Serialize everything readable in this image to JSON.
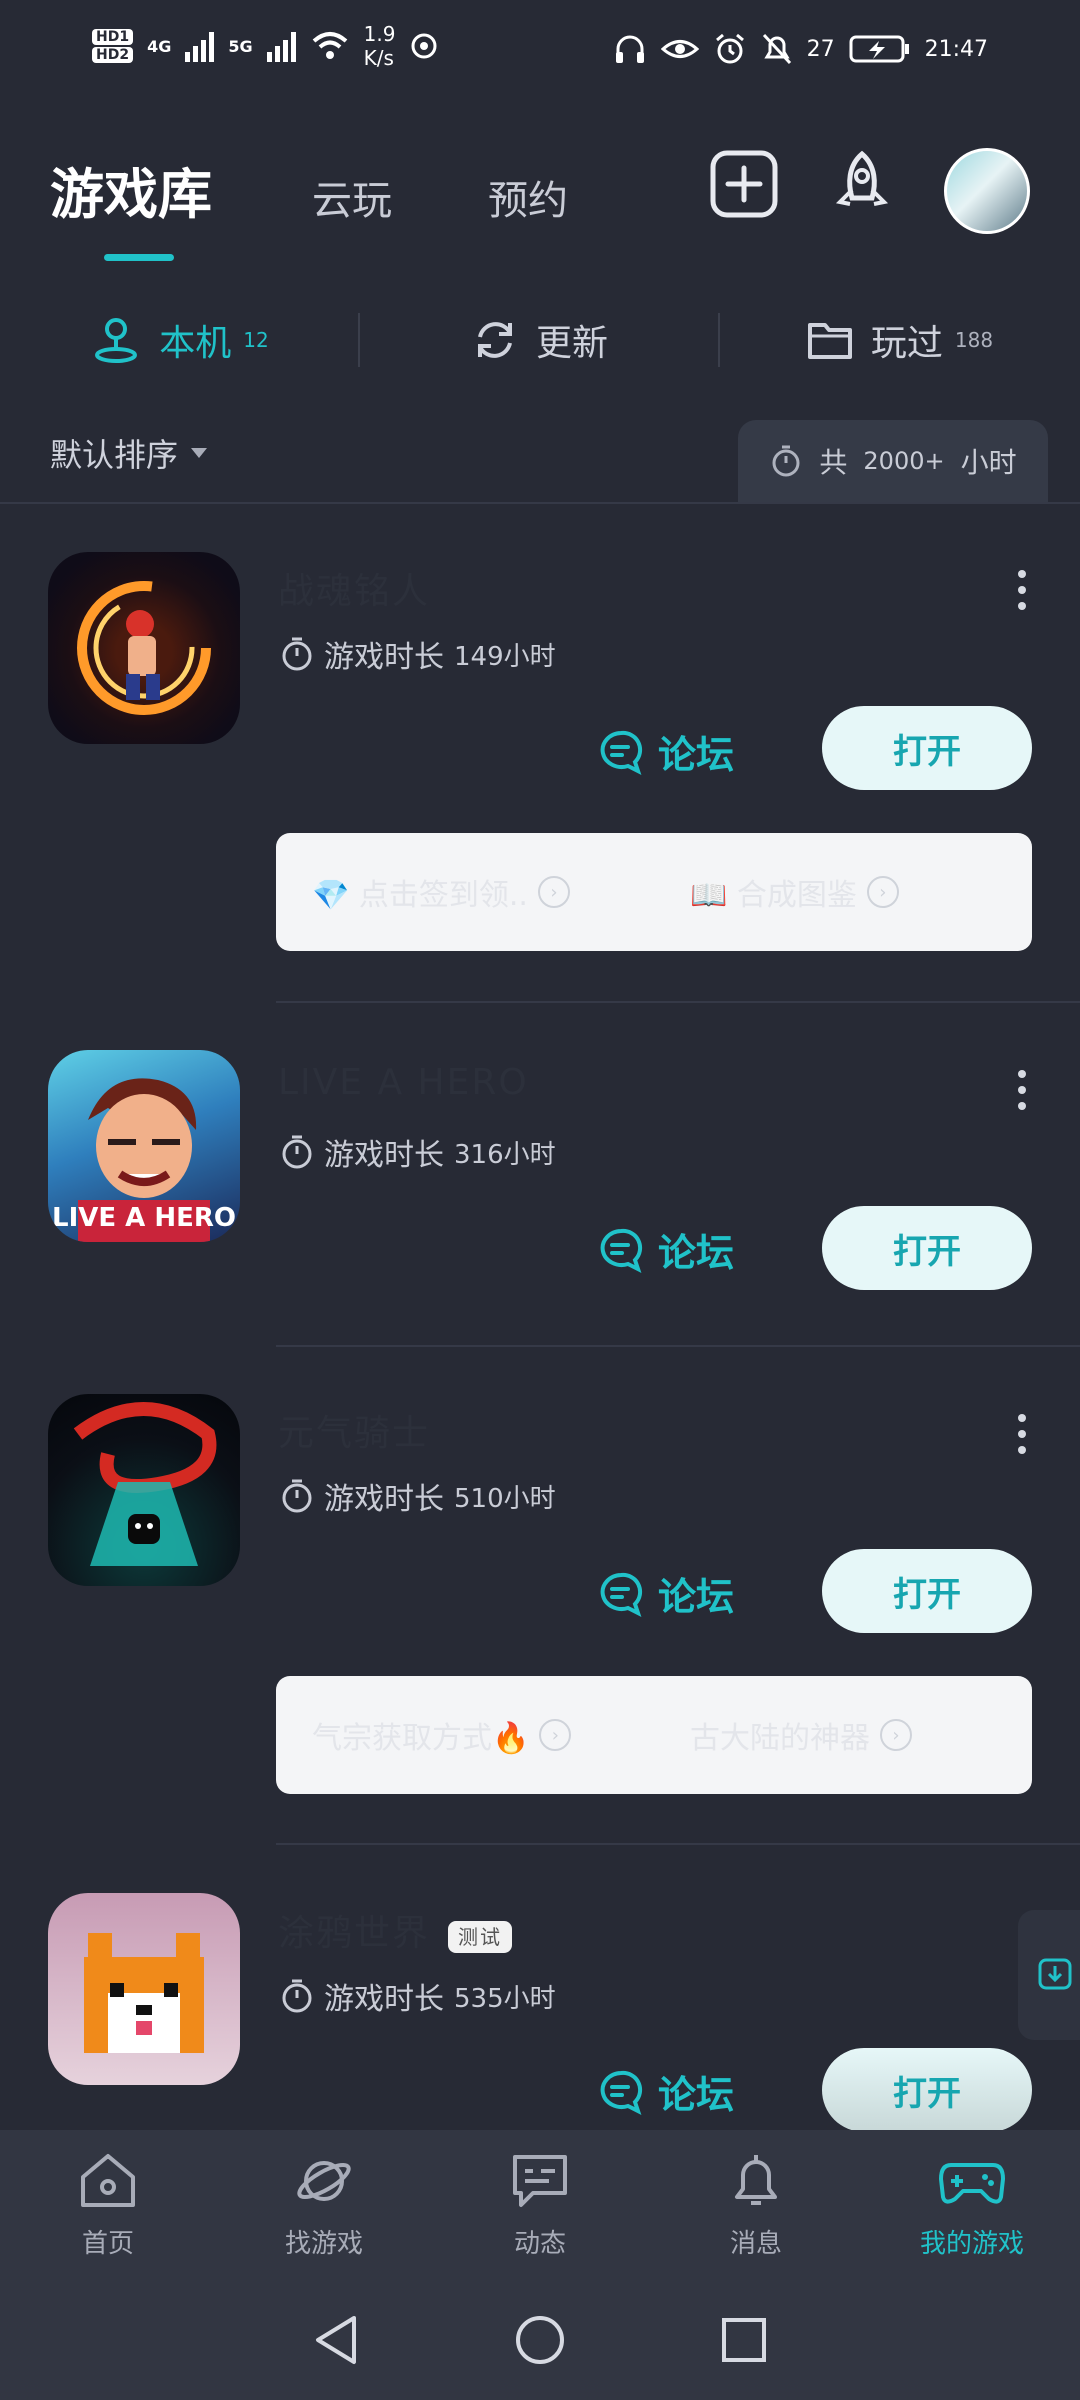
{
  "status_bar": {
    "network_left": [
      "HD1",
      "HD2"
    ],
    "net_type_1": "4G",
    "net_type_2": "5G",
    "speed_value": "1.9",
    "speed_unit": "K/s",
    "battery": "27",
    "time": "21:47"
  },
  "header": {
    "title": "游戏库",
    "tabs": [
      "云玩",
      "预约"
    ]
  },
  "filters": [
    {
      "label": "本机",
      "count": "12",
      "active": true
    },
    {
      "label": "更新",
      "count": "",
      "active": false
    },
    {
      "label": "玩过",
      "count": "188",
      "active": false
    }
  ],
  "sort": {
    "label": "默认排序",
    "total_prefix": "共",
    "total_value": "2000+",
    "total_unit": "小时"
  },
  "games": [
    {
      "title": "战魂铭人",
      "playtime_label": "游戏时长",
      "hours": "149小时",
      "forum": "论坛",
      "open": "打开",
      "tag": "",
      "links": [
        "💎 点击签到领..",
        "📖 合成图鉴"
      ]
    },
    {
      "title": "LIVE A HERO",
      "playtime_label": "游戏时长",
      "hours": "316小时",
      "forum": "论坛",
      "open": "打开",
      "tag": "",
      "links": []
    },
    {
      "title": "元气骑士",
      "playtime_label": "游戏时长",
      "hours": "510小时",
      "forum": "论坛",
      "open": "打开",
      "tag": "",
      "links": [
        "气宗获取方式🔥",
        "古大陆的神器"
      ]
    },
    {
      "title": "涂鸦世界",
      "playtime_label": "游戏时长",
      "hours": "535小时",
      "forum": "论坛",
      "open": "打开",
      "tag": "测试",
      "links": []
    }
  ],
  "bottom_nav": [
    {
      "label": "首页",
      "icon": "home-icon",
      "active": false
    },
    {
      "label": "找游戏",
      "icon": "planet-icon",
      "active": false
    },
    {
      "label": "动态",
      "icon": "chat-icon",
      "active": false
    },
    {
      "label": "消息",
      "icon": "bell-icon",
      "active": false
    },
    {
      "label": "我的游戏",
      "icon": "gamepad-icon",
      "active": true
    }
  ],
  "colors": {
    "accent": "#20c2c9",
    "background": "#272a35",
    "nav_background": "#323642"
  }
}
